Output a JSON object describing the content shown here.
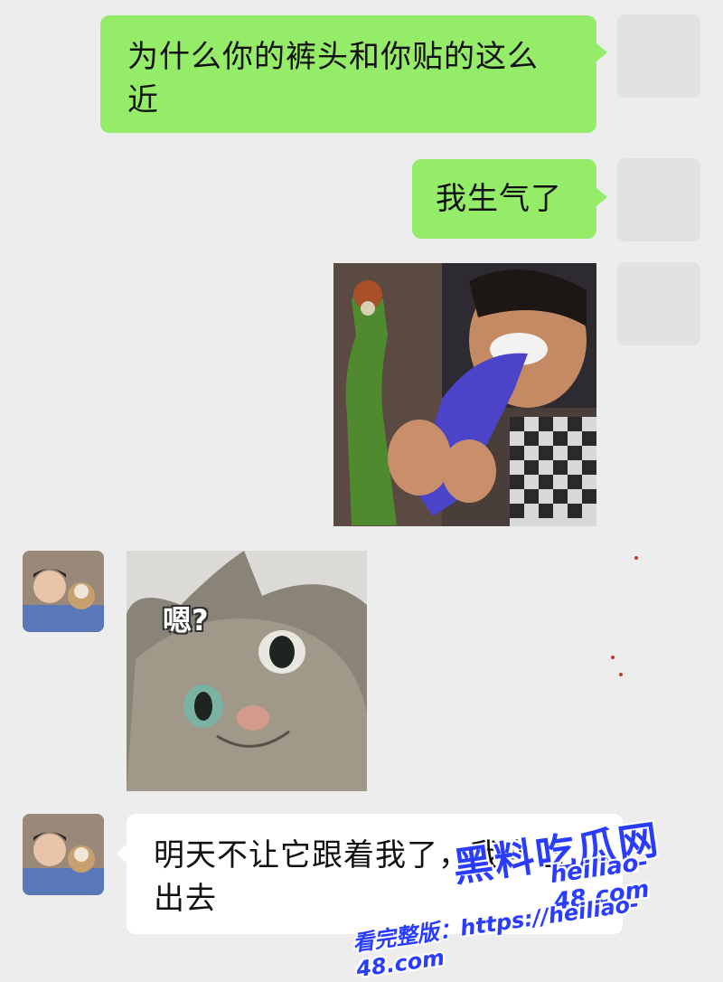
{
  "messages": {
    "m1_text": "为什么你的裤头和你贴的这么近",
    "m2_text": "我生气了",
    "m4_sticker_text": "嗯?",
    "m5_text": "明天不让它跟着我了，我自己出去"
  },
  "watermark": {
    "site": "黑料吃瓜网",
    "domain": "heiliao-48.com",
    "prompt": "看完整版：https://heiliao-48.com"
  },
  "colors": {
    "background": "#ededed",
    "self_bubble": "#95ec69",
    "friend_bubble": "#ffffff",
    "watermark": "#2a3cff"
  }
}
